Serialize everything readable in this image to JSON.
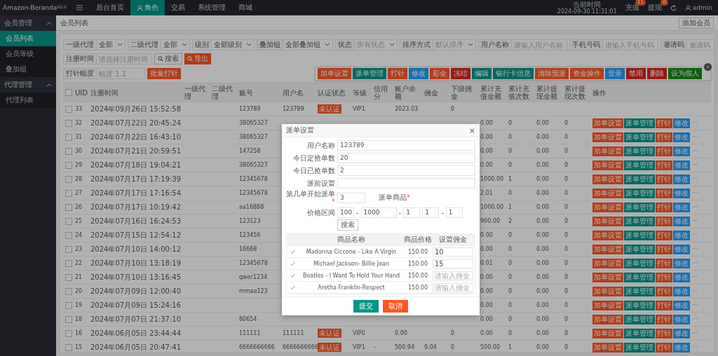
{
  "app": {
    "name": "Amazon-Beranda",
    "version": "V2.0"
  },
  "top_nav": [
    {
      "label": "后台首页",
      "selected": false
    },
    {
      "label": "角色",
      "selected": true
    },
    {
      "label": "交易",
      "selected": false
    },
    {
      "label": "系统管理",
      "selected": false
    },
    {
      "label": "商城",
      "selected": false
    }
  ],
  "header_right": {
    "time_label": "当前时间",
    "time": "2024-09-30 11:31:01",
    "recharge": {
      "label": "充值",
      "count": "11"
    },
    "withdraw": {
      "label": "提现",
      "count": "0"
    },
    "user": "admin"
  },
  "sidebar": [
    {
      "label": "会员管理",
      "expanded": true,
      "children": [
        {
          "label": "会员列表",
          "selected": true
        },
        {
          "label": "会员等级",
          "selected": false
        },
        {
          "label": "叠加组",
          "selected": false
        }
      ]
    },
    {
      "label": "代理管理",
      "expanded": true,
      "children": [
        {
          "label": "代理列表",
          "selected": false
        }
      ]
    }
  ],
  "breadcrumb": "会员列表",
  "add_button": "添加会员",
  "filters": [
    {
      "label": "一级代理",
      "kind": "select",
      "value": "全部"
    },
    {
      "label": "二级代理",
      "kind": "select",
      "value": "全部"
    },
    {
      "label": "级别",
      "kind": "select",
      "value": "全部级别"
    },
    {
      "label": "叠加组",
      "kind": "select",
      "value": "全部叠加组"
    },
    {
      "label": "状态",
      "kind": "select",
      "placeholder": "所有状态"
    },
    {
      "label": "排序方式",
      "kind": "select",
      "placeholder": "默认排序"
    },
    {
      "label": "用户名称",
      "kind": "input",
      "placeholder": "请输入用户名称"
    },
    {
      "label": "手机号码",
      "kind": "input",
      "placeholder": "请输入手机号码"
    },
    {
      "label": "邀请码",
      "kind": "input",
      "placeholder": "邀请码"
    }
  ],
  "date_filter": {
    "label": "注册时间",
    "placeholder": "请选择注册时间"
  },
  "search_button": "搜索",
  "export_button": "导出",
  "injection_filter": {
    "label": "打针幅度",
    "placeholder": "幅度 1.1"
  },
  "batch_button": "批量打针",
  "row_menu": [
    {
      "label": "加单设置",
      "kind": "warm"
    },
    {
      "label": "派单管理",
      "kind": "normal"
    },
    {
      "label": "打针",
      "kind": "warm"
    },
    {
      "label": "修改",
      "kind": "info"
    },
    {
      "label": "彩金",
      "kind": "warm"
    },
    {
      "label": "冻结",
      "kind": "danger"
    },
    {
      "label": "编辑",
      "kind": "normal"
    },
    {
      "label": "银行卡信息",
      "kind": "normal"
    },
    {
      "label": "清除预派",
      "kind": "warm"
    },
    {
      "label": "资金操作",
      "kind": "warm"
    },
    {
      "label": "登录",
      "kind": "info"
    },
    {
      "label": "禁用",
      "kind": "danger"
    },
    {
      "label": "删除",
      "kind": "danger"
    },
    {
      "label": "设为假人",
      "kind": "success"
    }
  ],
  "table": {
    "all_checked": false,
    "columns": [
      "UID",
      "注册时间",
      "一级代理",
      "二级代理",
      "账号",
      "用户名",
      "认证状态",
      "等级",
      "信用分",
      "账户余额",
      "佣金",
      "下级佣金",
      "累计充值金额",
      "累计充值次数",
      "累计提现金额",
      "累计提现次数",
      "操作"
    ],
    "rows": [
      {
        "checked": false,
        "uid": "33",
        "registered": "2024年09月26日 15:52:58",
        "account": "123789",
        "username": "123789",
        "verify": "未认证",
        "level": "VIP1",
        "balance": "2023.03",
        "sub_commission": "0"
      },
      {
        "checked": false,
        "uid": "32",
        "registered": "2024年07月22日 20:45:24",
        "account": "38065327",
        "recharge_total": "0.00",
        "recharge_count": "0",
        "withdraw_total": "0.00",
        "withdraw_count": "0",
        "actions": [
          {
            "label": "加单设置",
            "kind": "warm"
          },
          {
            "label": "派单管理",
            "kind": "normal"
          },
          {
            "label": "打针",
            "kind": "warm"
          },
          {
            "label": "修改",
            "kind": "info"
          }
        ],
        "more": "···"
      },
      {
        "checked": false,
        "uid": "31",
        "registered": "2024年07月22日 16:43:10",
        "account": "38065327",
        "recharge_total": "0.00",
        "recharge_count": "0",
        "withdraw_total": "0.00",
        "withdraw_count": "0",
        "actions": [
          {
            "label": "加单设置",
            "kind": "warm"
          },
          {
            "label": "派单管理",
            "kind": "normal"
          },
          {
            "label": "打针",
            "kind": "warm"
          },
          {
            "label": "修改",
            "kind": "info"
          }
        ],
        "more": "···"
      },
      {
        "checked": false,
        "uid": "30",
        "registered": "2024年07月21日 20:59:51",
        "account": "147258",
        "recharge_total": "0.00",
        "recharge_count": "0",
        "withdraw_total": "0.00",
        "withdraw_count": "0",
        "actions": [
          {
            "label": "加单设置",
            "kind": "warm"
          },
          {
            "label": "派单管理",
            "kind": "normal"
          },
          {
            "label": "打针",
            "kind": "warm"
          },
          {
            "label": "修改",
            "kind": "info"
          }
        ],
        "more": "···"
      },
      {
        "checked": false,
        "uid": "29",
        "registered": "2024年07月18日 19:04:21",
        "account": "38065327",
        "recharge_total": "0.00",
        "recharge_count": "0",
        "withdraw_total": "0.00",
        "withdraw_count": "0",
        "actions": [
          {
            "label": "加单设置",
            "kind": "warm"
          },
          {
            "label": "派单管理",
            "kind": "normal"
          },
          {
            "label": "打针",
            "kind": "warm"
          },
          {
            "label": "修改",
            "kind": "info"
          }
        ],
        "more": "···"
      },
      {
        "checked": false,
        "uid": "28",
        "registered": "2024年07月17日 17:19:39",
        "account": "12345678",
        "recharge_total": "1000.00",
        "recharge_count": "1",
        "withdraw_total": "0.00",
        "withdraw_count": "0",
        "actions": [
          {
            "label": "加单设置",
            "kind": "warm"
          },
          {
            "label": "派单管理",
            "kind": "normal"
          },
          {
            "label": "打针",
            "kind": "warm"
          },
          {
            "label": "修改",
            "kind": "info"
          }
        ],
        "more": "···"
      },
      {
        "checked": false,
        "uid": "27",
        "registered": "2024年07月17日 17:16:54",
        "account": "12345678",
        "recharge_total": "2.01",
        "recharge_count": "0",
        "withdraw_total": "0.00",
        "withdraw_count": "0",
        "actions": [
          {
            "label": "加单设置",
            "kind": "warm"
          },
          {
            "label": "派单管理",
            "kind": "normal"
          },
          {
            "label": "打针",
            "kind": "warm"
          },
          {
            "label": "修改",
            "kind": "info"
          }
        ],
        "more": "···"
      },
      {
        "checked": false,
        "uid": "26",
        "registered": "2024年07月17日 10:19:42",
        "account": "aa16888",
        "recharge_total": "1000.00",
        "recharge_count": "1",
        "withdraw_total": "0.00",
        "withdraw_count": "0",
        "actions": [
          {
            "label": "加单设置",
            "kind": "warm"
          },
          {
            "label": "派单管理",
            "kind": "normal"
          },
          {
            "label": "打针",
            "kind": "warm"
          },
          {
            "label": "修改",
            "kind": "info"
          }
        ],
        "more": "···"
      },
      {
        "checked": false,
        "uid": "25",
        "registered": "2024年07月16日 16:24:53",
        "account": "123123",
        "recharge_total": "900.00",
        "recharge_count": "2",
        "withdraw_total": "0.00",
        "withdraw_count": "0",
        "actions": [
          {
            "label": "加单设置",
            "kind": "warm"
          },
          {
            "label": "派单管理",
            "kind": "normal"
          },
          {
            "label": "打针",
            "kind": "warm"
          },
          {
            "label": "修改",
            "kind": "info"
          }
        ],
        "more": "···"
      },
      {
        "checked": false,
        "uid": "24",
        "registered": "2024年07月15日 12:54:12",
        "account": "123456",
        "recharge_total": "0.00",
        "recharge_count": "0",
        "withdraw_total": "0.00",
        "withdraw_count": "0",
        "actions": [
          {
            "label": "加单设置",
            "kind": "warm"
          },
          {
            "label": "派单管理",
            "kind": "normal"
          },
          {
            "label": "打针",
            "kind": "warm"
          },
          {
            "label": "修改",
            "kind": "info"
          }
        ],
        "more": "···"
      },
      {
        "checked": false,
        "uid": "23",
        "registered": "2024年07月10日 14:00:12",
        "account": "16668",
        "recharge_total": "0.00",
        "recharge_count": "0",
        "withdraw_total": "0.00",
        "withdraw_count": "0",
        "actions": [
          {
            "label": "加单设置",
            "kind": "warm"
          },
          {
            "label": "派单管理",
            "kind": "normal"
          },
          {
            "label": "打针",
            "kind": "warm"
          },
          {
            "label": "修改",
            "kind": "info"
          }
        ],
        "more": "···"
      },
      {
        "checked": false,
        "uid": "22",
        "registered": "2024年07月10日 13:18:19",
        "account": "12345678",
        "recharge_total": "0.01",
        "recharge_count": "0",
        "withdraw_total": "0.00",
        "withdraw_count": "0",
        "actions": [
          {
            "label": "加单设置",
            "kind": "warm"
          },
          {
            "label": "派单管理",
            "kind": "normal"
          },
          {
            "label": "打针",
            "kind": "warm"
          },
          {
            "label": "修改",
            "kind": "info"
          }
        ],
        "more": "···"
      },
      {
        "checked": false,
        "uid": "21",
        "registered": "2024年07月10日 13:16:45",
        "account": "qwer1234",
        "recharge_total": "0.00",
        "recharge_count": "0",
        "withdraw_total": "0.00",
        "withdraw_count": "0",
        "actions": [
          {
            "label": "加单设置",
            "kind": "warm"
          },
          {
            "label": "派单管理",
            "kind": "normal"
          },
          {
            "label": "打针",
            "kind": "warm"
          },
          {
            "label": "修改",
            "kind": "info"
          }
        ],
        "more": "···"
      },
      {
        "checked": false,
        "uid": "20",
        "registered": "2024年07月09日 12:00:40",
        "account": "mmaa123",
        "recharge_total": "0.00",
        "recharge_count": "0",
        "withdraw_total": "0.00",
        "withdraw_count": "0",
        "actions": [
          {
            "label": "加单设置",
            "kind": "warm"
          },
          {
            "label": "派单管理",
            "kind": "normal"
          },
          {
            "label": "打针",
            "kind": "warm"
          },
          {
            "label": "修改",
            "kind": "info"
          }
        ],
        "more": "···"
      },
      {
        "checked": false,
        "uid": "19",
        "registered": "2024年07月09日 15:24:16",
        "recharge_total": "0.00",
        "recharge_count": "0",
        "withdraw_total": "0.00",
        "withdraw_count": "0",
        "actions": [
          {
            "label": "加单设置",
            "kind": "warm"
          },
          {
            "label": "派单管理",
            "kind": "normal"
          },
          {
            "label": "打针",
            "kind": "warm"
          },
          {
            "label": "修改",
            "kind": "info"
          }
        ],
        "more": "···"
      },
      {
        "checked": false,
        "uid": "18",
        "registered": "2024年07月07日 21:37:10",
        "account": "80654",
        "recharge_total": "0.00",
        "recharge_count": "0",
        "withdraw_total": "0.00",
        "withdraw_count": "0",
        "actions": [
          {
            "label": "加单设置",
            "kind": "warm"
          },
          {
            "label": "派单管理",
            "kind": "normal"
          },
          {
            "label": "打针",
            "kind": "warm"
          },
          {
            "label": "修改",
            "kind": "info"
          }
        ],
        "more": "···"
      },
      {
        "checked": false,
        "uid": "16",
        "registered": "2024年06月05日 23:44:44",
        "account": "111111",
        "username": "111111",
        "verify": "未认证",
        "level": "VIP0",
        "balance": "0.00",
        "sub_commission": "0",
        "recharge_total": "0.00",
        "recharge_count": "0",
        "withdraw_total": "0.00",
        "withdraw_count": "0",
        "actions": [
          {
            "label": "加单设置",
            "kind": "warm"
          },
          {
            "label": "派单管理",
            "kind": "normal"
          },
          {
            "label": "打针",
            "kind": "warm"
          },
          {
            "label": "修改",
            "kind": "info"
          }
        ],
        "more": "···"
      },
      {
        "checked": false,
        "uid": "15",
        "registered": "2024年06月05日 20:47:41",
        "account": "6666666666",
        "username": "6666666666",
        "verify": "未认证",
        "level": "VIP1",
        "col9": "-",
        "balance": "500.94",
        "commission": "9.04",
        "sub_commission": "0",
        "recharge_total": "500.00",
        "recharge_count": "1",
        "withdraw_total": "0.00",
        "withdraw_count": "0",
        "actions": [
          {
            "label": "加单设置",
            "kind": "warm"
          },
          {
            "label": "派单管理",
            "kind": "normal"
          },
          {
            "label": "打针",
            "kind": "warm"
          },
          {
            "label": "修改",
            "kind": "info"
          }
        ],
        "more": "···"
      }
    ]
  },
  "modal": {
    "title": "派单设置",
    "close": "×",
    "fields": [
      {
        "label": "用户名称",
        "value": "123789"
      },
      {
        "label": "今日定抢单数",
        "value": "20"
      },
      {
        "label": "今日已抢单数",
        "value": "2"
      },
      {
        "label": "派前设置"
      }
    ],
    "start_order": {
      "label": "第几单开始派单",
      "mark": "*",
      "value": "3"
    },
    "goods_label": {
      "label": "派单商品",
      "mark": "*"
    },
    "price_range": {
      "label": "价格区间",
      "separator": "-",
      "pairs": [
        {
          "min": "100",
          "max": "1000"
        },
        {
          "max": "1"
        },
        {
          "min": "1",
          "max": "1"
        }
      ]
    },
    "search_button": "搜索",
    "goods_columns": [
      "商品名称",
      "商品价格",
      "设置佣金"
    ],
    "goods": [
      {
        "checked": true,
        "name": "Madonna Ciccone - Like A Virgin",
        "price": "150.00",
        "commission": "10"
      },
      {
        "checked": true,
        "name": "Michael Jackson- Billie Jean",
        "price": "150.00",
        "commission": "15"
      },
      {
        "checked": true,
        "name": "Beatles - I Want To Hold Your Hand",
        "price": "150.00",
        "placeholder": "请输入佣金"
      },
      {
        "checked": true,
        "name": "Aretha Franklin-Respect",
        "price": "150.00",
        "placeholder": "请输入佣金"
      }
    ],
    "submit": "提交",
    "cancel": "取消"
  }
}
